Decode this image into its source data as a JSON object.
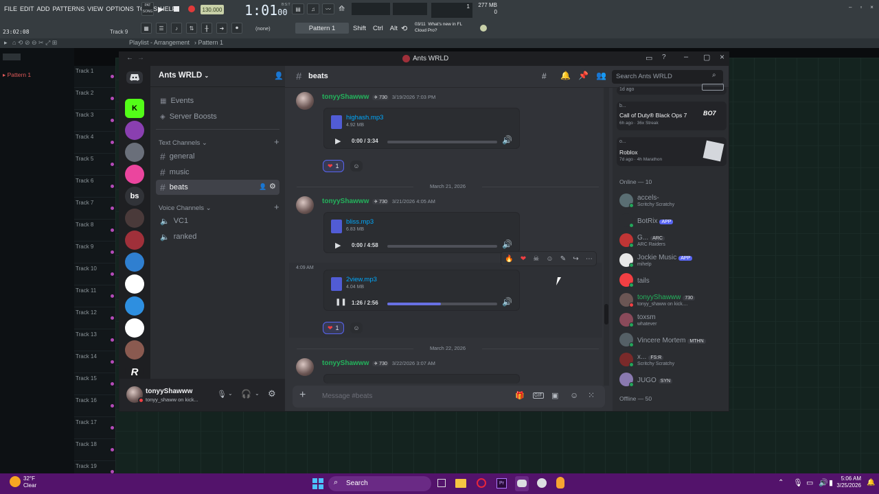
{
  "fl": {
    "menu": [
      "FILE",
      "EDIT",
      "ADD",
      "PATTERNS",
      "VIEW",
      "OPTIONS",
      "TOOLS",
      "HELP"
    ],
    "mode_pat": "PAT",
    "mode_song": "SONG",
    "tempo": "130.000",
    "time_main": "1:01",
    "time_sub": "00",
    "beat_marker": "B:S:T",
    "cpu_num": "1",
    "ram": "277 MB",
    "voices": "0",
    "clock": "23:02:08",
    "track_hint": "Track 9",
    "none_label": "(none)",
    "pattern_label": "Pattern 1",
    "keys": [
      "Shift",
      "Ctrl",
      "Alt"
    ],
    "news_date": "03/11",
    "news_line1": "What's new in FL",
    "news_line2": "Cloud Pro?",
    "playlist_title": "Playlist - Arrangement",
    "playlist_pattern": "Pattern 1",
    "left_pattern": "Pattern 1",
    "tracks": [
      "Track 1",
      "Track 2",
      "Track 3",
      "Track 4",
      "Track 5",
      "Track 6",
      "Track 7",
      "Track 8",
      "Track 9",
      "Track 10",
      "Track 11",
      "Track 12",
      "Track 13",
      "Track 14",
      "Track 15",
      "Track 16",
      "Track 17",
      "Track 18",
      "Track 19"
    ]
  },
  "discord": {
    "window_title": "Ants WRLD",
    "server_name": "Ants WRLD",
    "guilds": [
      {
        "label": "",
        "color": "#1e1f22"
      },
      {
        "label": "K",
        "color": "#53fc18"
      },
      {
        "label": "",
        "color": "#8a3fb0"
      },
      {
        "label": "",
        "color": "#6a6f7a"
      },
      {
        "label": "",
        "color": "#eb459e"
      },
      {
        "label": "bs",
        "color": "#2b2d31"
      },
      {
        "label": "",
        "color": "#4a3a3a"
      },
      {
        "label": "",
        "color": "#a0303a"
      },
      {
        "label": "",
        "color": "#2f7fd0"
      },
      {
        "label": "",
        "color": "#ffffff"
      },
      {
        "label": "",
        "color": "#2e8fe0"
      },
      {
        "label": "",
        "color": "#ffffff"
      },
      {
        "label": "",
        "color": "#8a5a50"
      },
      {
        "label": "R",
        "color": "#1e1f22"
      }
    ],
    "nav": {
      "events": "Events",
      "boosts": "Server Boosts"
    },
    "text_category": "Text Channels",
    "text_channels": [
      "general",
      "music",
      "beats"
    ],
    "voice_category": "Voice Channels",
    "voice_channels": [
      "VC1",
      "ranked"
    ],
    "user": {
      "name": "tonyyShawww",
      "status": "tonyy_shaww on kick..."
    },
    "channel": "beats",
    "search_placeholder": "Search Ants WRLD",
    "messages": [
      {
        "author": "tonyyShawww",
        "tag": "730",
        "timestamp": "3/19/2026 7:03 PM",
        "file": "highash.mp3",
        "size": "4.92 MB",
        "time": "0:00 / 3:34",
        "progress": 0.0,
        "reaction_count": "1"
      },
      {
        "author": "tonyyShawww",
        "tag": "730",
        "timestamp": "3/21/2026 4:05 AM",
        "file": "bliss.mp3",
        "size": "6.83 MB",
        "time": "0:00 / 4:58",
        "progress": 0.0
      },
      {
        "author": "",
        "tag": "",
        "timestamp": "4:09 AM",
        "file": "2view.mp3",
        "size": "4.04 MB",
        "time": "1:26 / 2:56",
        "progress": 0.49,
        "reaction_count": "1"
      },
      {
        "author": "tonyyShawww",
        "tag": "730",
        "timestamp": "3/22/2026 3:07 AM"
      }
    ],
    "date_dividers": [
      "March 21, 2026",
      "March 22, 2026"
    ],
    "composer_placeholder": "Message #beats",
    "activities": [
      {
        "title": "",
        "sub": "1d ago"
      },
      {
        "title": "Call of Duty® Black Ops 7",
        "pre": "b...",
        "sub": "6h ago · 36x Streak",
        "badge": "BO7"
      },
      {
        "title": "Roblox",
        "pre": "o...",
        "sub": "7d ago · 4h Marathon"
      }
    ],
    "online_header": "Online — 10",
    "members": [
      {
        "name": "accels-",
        "status": "Scritchy Scratchy",
        "color": "#5a6e73"
      },
      {
        "name": "BotRix",
        "app": "APP",
        "color": "#2b2d31"
      },
      {
        "name": "G...",
        "badge": "ARC",
        "status": "ARC Raiders",
        "color": "#c03535"
      },
      {
        "name": "Jockie Music",
        "app": "APP",
        "status": "mihelp",
        "color": "#e8e8e8"
      },
      {
        "name": "tails",
        "color": "#f23f43"
      },
      {
        "name": "tonyyShawww",
        "badge": "730",
        "status": "tonyy_shaww on kick....",
        "color": "#6b5654",
        "green": true
      },
      {
        "name": "toxsm",
        "status": "whatever",
        "color": "#8a4a5a"
      },
      {
        "name": "Vincere Mortem",
        "badge": "MTHN",
        "color": "#556066"
      },
      {
        "name": "x...",
        "badge": "FS:R",
        "status": "Scritchy Scratchy",
        "color": "#7a2a2a"
      },
      {
        "name": "JUGO",
        "badge": "SYN",
        "color": "#8a7ab0"
      }
    ],
    "offline_header": "Offline — 50"
  },
  "taskbar": {
    "weather_temp": "32°F",
    "weather_desc": "Clear",
    "search": "Search",
    "time": "5:06 AM",
    "date": "3/25/2026"
  },
  "colors": {
    "accent": "#5865f2",
    "online": "#23a55a",
    "taskbar": "#53136b",
    "fl_grid": "#14231f"
  }
}
